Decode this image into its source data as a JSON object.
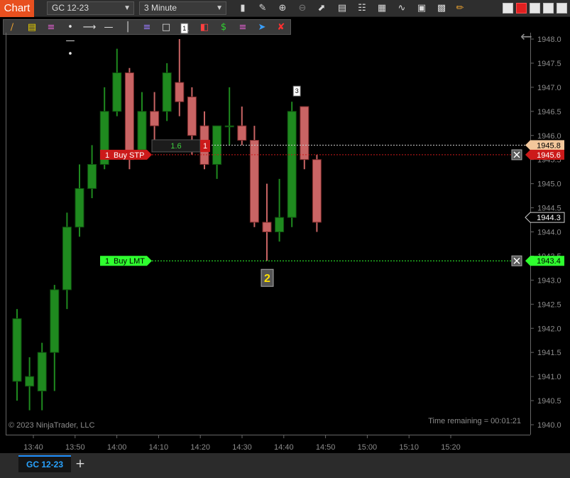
{
  "titlebar": {
    "app_name": "Chart",
    "instrument": "GC 12-23",
    "interval": "3 Minute",
    "icons": [
      "bar-style-icon",
      "draw-icon",
      "zoom-in-icon",
      "zoom-out-icon",
      "pointer-icon",
      "properties-icon",
      "indicators-icon",
      "strategies-icon",
      "templates-icon",
      "pencil-icon"
    ],
    "window_buttons": [
      "minimize-icon",
      "close-window-icon",
      "maximize-icon",
      "popout-icon"
    ]
  },
  "drawing_toolbar": {
    "icons": [
      "line-icon",
      "fib-retracement-icon",
      "fib-extension-icon",
      "ray-icon",
      "arrow-line-icon",
      "horizontal-line-icon",
      "vertical-line-icon",
      "channel-icon",
      "rectangle-icon",
      "triangle-icon",
      "region-icon",
      "dollar-icon",
      "text-icon",
      "pointer-arrow-icon",
      "remove-drawings-icon"
    ]
  },
  "chart": {
    "copyright": "© 2023 NinjaTrader, LLC",
    "time_remaining": "Time remaining = 00:01:21",
    "colors": {
      "up": "#1f8a1f",
      "down": "#c96464",
      "buy_stp": "#cc1a1a",
      "buy_lmt": "#2fff2f",
      "axis_text": "#8c8c8c"
    }
  },
  "orders": {
    "buy_stp": {
      "qty": "1",
      "label": "Buy STP",
      "price": "1945.6",
      "pnl": "1.6",
      "position_qty": "1"
    },
    "buy_lmt": {
      "qty": "1",
      "label": "Buy LMT",
      "price": "1943.4"
    },
    "last_price": "1945.8",
    "cursor_price": "1944.3"
  },
  "chart_data": {
    "type": "candlestick",
    "y_ticks": [
      1948,
      1947.5,
      1947,
      1946.5,
      1946,
      1945.5,
      1945,
      1944.5,
      1944,
      1943.5,
      1943,
      1942.5,
      1942,
      1941.5,
      1941,
      1940.5,
      1940
    ],
    "y_labels": [
      "1948.0",
      "1947.5",
      "1947.0",
      "1946.5",
      "1946.0",
      "1945.5",
      "1945.0",
      "1944.5",
      "1944.0",
      "1943.5",
      "1943.0",
      "1942.5",
      "1942.0",
      "1941.5",
      "1941.0",
      "1940.5",
      "1940.0"
    ],
    "x_labels": [
      "13:40",
      "13:50",
      "14:00",
      "14:10",
      "14:20",
      "14:30",
      "14:40",
      "14:50",
      "15:00",
      "15:10",
      "15:20"
    ],
    "ylim": [
      1939.9,
      1948.5
    ],
    "candles": [
      {
        "o": 1940.9,
        "h": 1942.4,
        "l": 1940.5,
        "c": 1942.2
      },
      {
        "o": 1940.8,
        "h": 1941.4,
        "l": 1940.3,
        "c": 1941.0
      },
      {
        "o": 1940.7,
        "h": 1941.7,
        "l": 1940.3,
        "c": 1941.5
      },
      {
        "o": 1941.5,
        "h": 1942.9,
        "l": 1940.7,
        "c": 1942.8
      },
      {
        "o": 1942.8,
        "h": 1944.4,
        "l": 1942.4,
        "c": 1944.1
      },
      {
        "o": 1944.1,
        "h": 1945.4,
        "l": 1943.9,
        "c": 1944.9
      },
      {
        "o": 1944.9,
        "h": 1945.8,
        "l": 1944.7,
        "c": 1945.4
      },
      {
        "o": 1945.4,
        "h": 1947.0,
        "l": 1945.3,
        "c": 1946.5
      },
      {
        "o": 1946.5,
        "h": 1947.8,
        "l": 1946.4,
        "c": 1947.3
      },
      {
        "o": 1947.3,
        "h": 1947.4,
        "l": 1945.3,
        "c": 1945.5
      },
      {
        "o": 1945.7,
        "h": 1946.9,
        "l": 1945.5,
        "c": 1946.5
      },
      {
        "o": 1946.5,
        "h": 1946.9,
        "l": 1945.8,
        "c": 1946.2
      },
      {
        "o": 1946.5,
        "h": 1947.5,
        "l": 1946.3,
        "c": 1947.3
      },
      {
        "o": 1947.1,
        "h": 1948.0,
        "l": 1946.4,
        "c": 1946.7
      },
      {
        "o": 1946.8,
        "h": 1947.0,
        "l": 1945.6,
        "c": 1946.0
      },
      {
        "o": 1946.2,
        "h": 1946.5,
        "l": 1945.3,
        "c": 1945.4
      },
      {
        "o": 1945.4,
        "h": 1946.2,
        "l": 1945.1,
        "c": 1946.2
      },
      {
        "o": 1946.2,
        "h": 1947.0,
        "l": 1945.8,
        "c": 1946.2
      },
      {
        "o": 1946.2,
        "h": 1946.6,
        "l": 1945.8,
        "c": 1945.9
      },
      {
        "o": 1945.9,
        "h": 1946.2,
        "l": 1944.1,
        "c": 1944.2
      },
      {
        "o": 1944.2,
        "h": 1945.0,
        "l": 1943.4,
        "c": 1944.0
      },
      {
        "o": 1944.0,
        "h": 1945.1,
        "l": 1943.8,
        "c": 1944.3
      },
      {
        "o": 1944.3,
        "h": 1946.7,
        "l": 1944.1,
        "c": 1946.5
      },
      {
        "o": 1946.6,
        "h": 1946.6,
        "l": 1945.3,
        "c": 1945.5
      },
      {
        "o": 1945.5,
        "h": 1945.6,
        "l": 1944.0,
        "c": 1944.2
      }
    ],
    "annotations": [
      {
        "text": "1",
        "candle": 13
      },
      {
        "text": "3",
        "candle": 22
      },
      {
        "text": "2",
        "candle": 20
      }
    ]
  }
}
